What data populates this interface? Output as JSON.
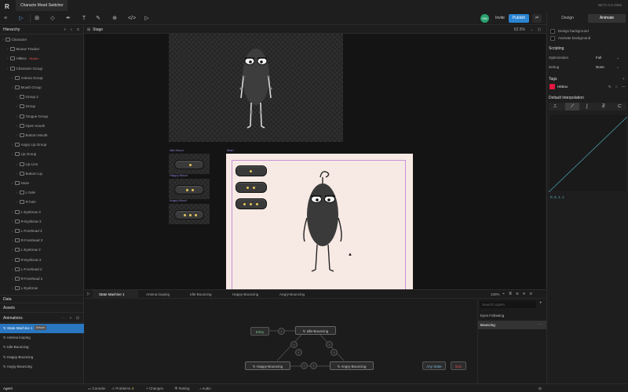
{
  "app": {
    "tab_title": "Characte Mood Switcher",
    "version": "BETA 0.8.3866",
    "logo": "R"
  },
  "toolbar": {
    "avatar_initial": "RM",
    "invite": "Invite",
    "publish": "Publish",
    "share": "⇄"
  },
  "hierarchy": {
    "title": "Hierarchy",
    "items": [
      {
        "label": "Character",
        "indent": 0
      },
      {
        "label": "Mouse Tracker",
        "indent": 1
      },
      {
        "label": "HitBox",
        "indent": 1,
        "badge": "Hidden"
      },
      {
        "label": "Character Group",
        "indent": 1
      },
      {
        "label": "Antena Group",
        "indent": 2
      },
      {
        "label": "Mouth Group",
        "indent": 2
      },
      {
        "label": "Group 2",
        "indent": 3
      },
      {
        "label": "Group",
        "indent": 3
      },
      {
        "label": "Tongue Group",
        "indent": 3
      },
      {
        "label": "Open mouth",
        "indent": 3
      },
      {
        "label": "Bottom Mouth",
        "indent": 3
      },
      {
        "label": "Angry Lip Group",
        "indent": 2
      },
      {
        "label": "Lip Group",
        "indent": 2
      },
      {
        "label": "Lip Line",
        "indent": 3
      },
      {
        "label": "Bottom Lip",
        "indent": 3
      },
      {
        "label": "Nose",
        "indent": 2
      },
      {
        "label": "L-hole",
        "indent": 3
      },
      {
        "label": "R-hole",
        "indent": 3
      },
      {
        "label": "L-Eyebrow 3",
        "indent": 2
      },
      {
        "label": "R-Eyebrow 3",
        "indent": 2
      },
      {
        "label": "L-Forehead 3",
        "indent": 2
      },
      {
        "label": "R-Forehead 3",
        "indent": 2
      },
      {
        "label": "L-Eyebrow 2",
        "indent": 2
      },
      {
        "label": "R-Eyebrow 2",
        "indent": 2
      },
      {
        "label": "L-Forehead 2",
        "indent": 2
      },
      {
        "label": "R-Forehead 2",
        "indent": 2
      },
      {
        "label": "L-Eyebrow",
        "indent": 2
      }
    ]
  },
  "data_section": "Data",
  "assets_section": "Assets",
  "animations": {
    "title": "Animations",
    "items": [
      {
        "label": "State Machine 1",
        "tag": "Default",
        "selected": true
      },
      {
        "label": "Antena looping"
      },
      {
        "label": "Idle-Bouncing"
      },
      {
        "label": "Happy-Bouncing"
      },
      {
        "label": "Angry-Bouncing"
      }
    ]
  },
  "agent": "Agent",
  "stage": {
    "title": "Stage",
    "zoom": "62.5%",
    "artboards": {
      "idle": "Idle Mood",
      "happy": "Happy Mood",
      "angry": "Angry Mood",
      "main": "Main"
    }
  },
  "right_panel": {
    "tabs": [
      "Design",
      "Animate"
    ],
    "design_background": "Design background",
    "animate_background": "Animate background",
    "scripting": "Scripting",
    "optimization_label": "Optimization",
    "optimization_value": "Full",
    "debug_label": "Debug",
    "debug_value": "None",
    "tags_title": "Tags",
    "tag_name": "HitBox",
    "tag_color": "#e0173e",
    "interp_title": "Default Interpolation",
    "interp_values": "0, 0, 1, 1"
  },
  "timeline": {
    "tabs": [
      "State Machine 1",
      "Antena looping",
      "Idle-Bouncing",
      "Happy-Bouncing",
      "Angry-Bouncing"
    ],
    "zoom": "100%",
    "nodes": {
      "entry": "Entry",
      "idle": "Idle-Bouncing",
      "happy": "Happy-Bouncing",
      "angry": "Angry-Bouncing",
      "any": "Any State",
      "exit": "Exit"
    },
    "layers_search": "Search Layers",
    "layers": [
      "Eyes Following",
      "Bouncing"
    ]
  },
  "statusbar": {
    "console": "Console",
    "problems": "Problems",
    "problems_count": "4",
    "changes": "Changes",
    "testing": "Testing",
    "audio": "Audio"
  },
  "colors": {
    "accent": "#2a84d2",
    "selection": "#2a76c0",
    "artboard_label": "#8f86d8",
    "main_bg": "#f7e9e4",
    "exit": "#e05252"
  }
}
